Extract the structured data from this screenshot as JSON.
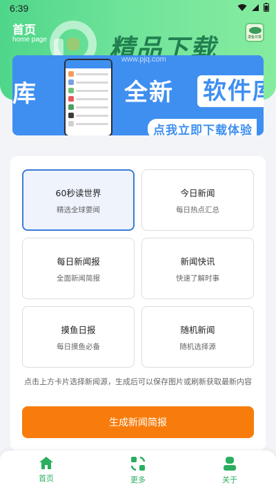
{
  "status": {
    "time": "6:39"
  },
  "header": {
    "title": "首页",
    "subtitle": "home page"
  },
  "watermark": {
    "brand": "精品下载",
    "url": "www.pjq.com",
    "logo_text": "摸鱼日报"
  },
  "banner": {
    "left_text": "库",
    "headline": "全新",
    "highlight": "软件库",
    "cta": "点我立即下载体验"
  },
  "sources": [
    {
      "title": "60秒读世界",
      "desc": "精选全球要闻",
      "selected": true
    },
    {
      "title": "今日新闻",
      "desc": "每日热点汇总",
      "selected": false
    },
    {
      "title": "每日新闻报",
      "desc": "全面新闻简报",
      "selected": false
    },
    {
      "title": "新闻快讯",
      "desc": "快速了解时事",
      "selected": false
    },
    {
      "title": "摸鱼日报",
      "desc": "每日摸鱼必备",
      "selected": false
    },
    {
      "title": "随机新闻",
      "desc": "随机选择源",
      "selected": false
    }
  ],
  "hint": "点击上方卡片选择新闻源，生成后可以保存图片或刷新获取最新内容",
  "generate_button": "生成新闻简报",
  "nav": [
    {
      "label": "首页",
      "icon": "home-icon"
    },
    {
      "label": "更多",
      "icon": "more-icon"
    },
    {
      "label": "关于",
      "icon": "user-icon"
    }
  ],
  "colors": {
    "header_green": "#4fd68a",
    "banner_blue": "#3f8ff0",
    "selected_border": "#3a7bd8",
    "button_orange": "#f77c0c",
    "nav_green": "#2aae5f"
  }
}
